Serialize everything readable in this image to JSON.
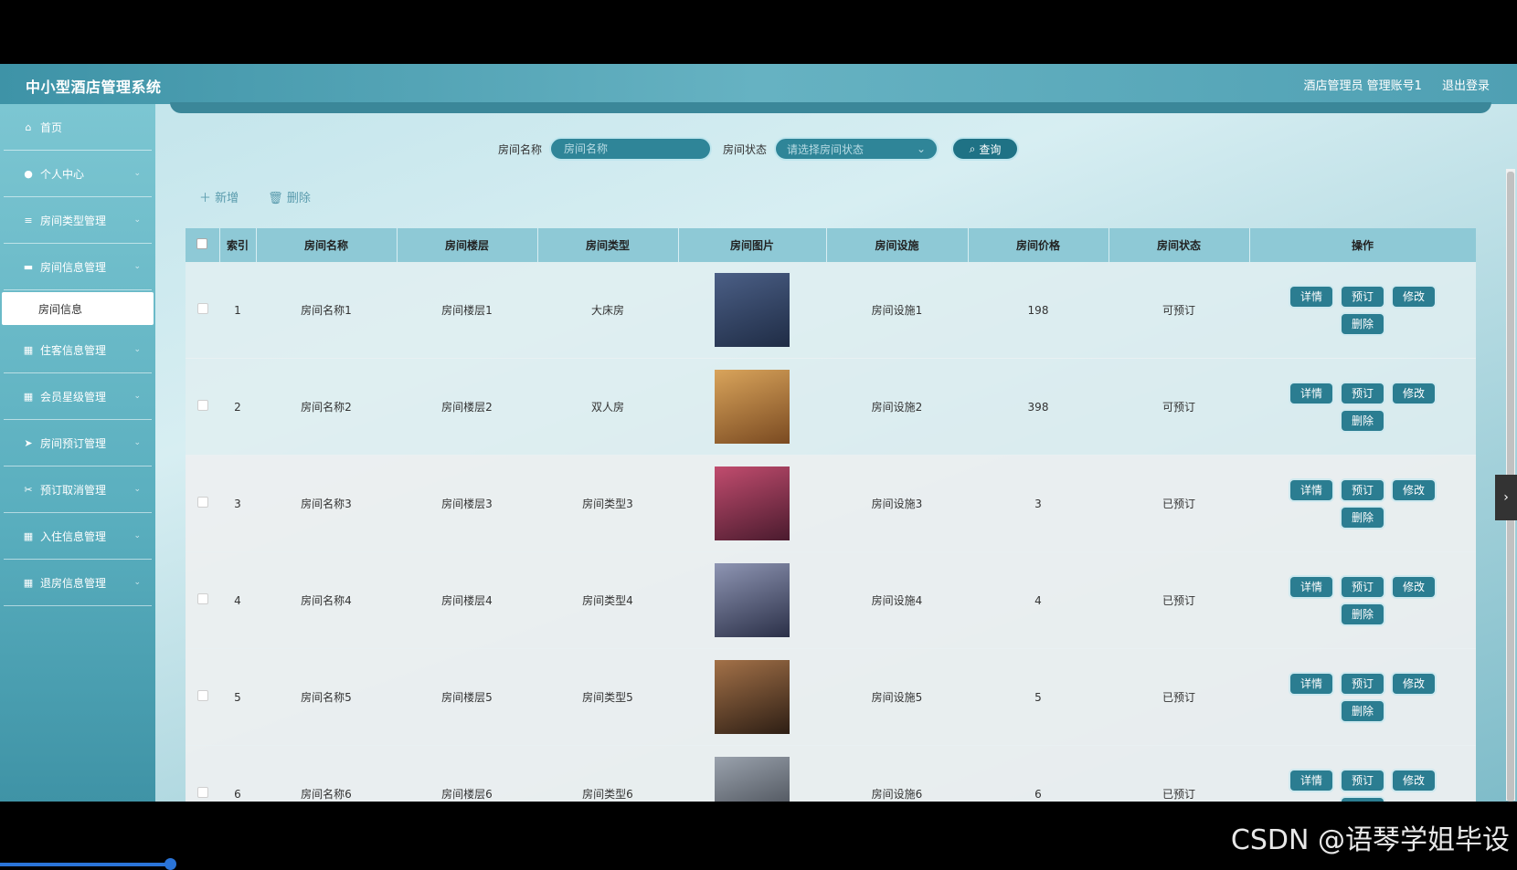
{
  "header": {
    "app_title": "中小型酒店管理系统",
    "user": "酒店管理员 管理账号1",
    "logout": "退出登录"
  },
  "sidebar": {
    "items": [
      {
        "label": "首页",
        "icon": "home-icon",
        "glyph": "⌂",
        "has_children": false
      },
      {
        "label": "个人中心",
        "icon": "user-icon",
        "glyph": "●",
        "has_children": true
      },
      {
        "label": "房间类型管理",
        "icon": "sliders-icon",
        "glyph": "≡",
        "has_children": true
      },
      {
        "label": "房间信息管理",
        "icon": "monitor-icon",
        "glyph": "▬",
        "has_children": true,
        "expanded": true,
        "children": [
          "房间信息"
        ]
      },
      {
        "label": "住客信息管理",
        "icon": "grid-icon",
        "glyph": "▦",
        "has_children": true
      },
      {
        "label": "会员星级管理",
        "icon": "grid-icon",
        "glyph": "▦",
        "has_children": true
      },
      {
        "label": "房间预订管理",
        "icon": "send-icon",
        "glyph": "➤",
        "has_children": true
      },
      {
        "label": "预订取消管理",
        "icon": "ticket-icon",
        "glyph": "✂",
        "has_children": true
      },
      {
        "label": "入住信息管理",
        "icon": "grid-icon",
        "glyph": "▦",
        "has_children": true
      },
      {
        "label": "退房信息管理",
        "icon": "grid-icon",
        "glyph": "▦",
        "has_children": true
      }
    ]
  },
  "search": {
    "name_label": "房间名称",
    "name_placeholder": "房间名称",
    "status_label": "房间状态",
    "status_placeholder": "请选择房间状态",
    "query_button": "查询"
  },
  "toolbar": {
    "add": "新增",
    "delete": "删除"
  },
  "table": {
    "columns": [
      "索引",
      "房间名称",
      "房间楼层",
      "房间类型",
      "房间图片",
      "房间设施",
      "房间价格",
      "房间状态",
      "操作"
    ],
    "actions": {
      "detail": "详情",
      "book": "预订",
      "edit": "修改",
      "delete": "删除"
    },
    "rows": [
      {
        "index": "1",
        "name": "房间名称1",
        "floor": "房间楼层1",
        "type": "大床房",
        "facility": "房间设施1",
        "price": "198",
        "status": "可预订",
        "image_colors": [
          "#4b5f86",
          "#1f2c45"
        ]
      },
      {
        "index": "2",
        "name": "房间名称2",
        "floor": "房间楼层2",
        "type": "双人房",
        "facility": "房间设施2",
        "price": "398",
        "status": "可预订",
        "image_colors": [
          "#d9a45b",
          "#7a4a21"
        ]
      },
      {
        "index": "3",
        "name": "房间名称3",
        "floor": "房间楼层3",
        "type": "房间类型3",
        "facility": "房间设施3",
        "price": "3",
        "status": "已预订",
        "image_colors": [
          "#c14c6e",
          "#4a1b2e"
        ]
      },
      {
        "index": "4",
        "name": "房间名称4",
        "floor": "房间楼层4",
        "type": "房间类型4",
        "facility": "房间设施4",
        "price": "4",
        "status": "已预订",
        "image_colors": [
          "#8e95b3",
          "#2b3048"
        ]
      },
      {
        "index": "5",
        "name": "房间名称5",
        "floor": "房间楼层5",
        "type": "房间类型5",
        "facility": "房间设施5",
        "price": "5",
        "status": "已预订",
        "image_colors": [
          "#a37148",
          "#2d1e14"
        ]
      },
      {
        "index": "6",
        "name": "房间名称6",
        "floor": "房间楼层6",
        "type": "房间类型6",
        "facility": "房间设施6",
        "price": "6",
        "status": "已预订",
        "image_colors": [
          "#9aa2ad",
          "#3a3f47"
        ]
      }
    ]
  },
  "watermark": "CSDN @语琴学姐毕设",
  "colors": {
    "primary": "#2b7d91",
    "header_row": "#8ec9d6",
    "sidebar_top": "#7cc6d2"
  }
}
